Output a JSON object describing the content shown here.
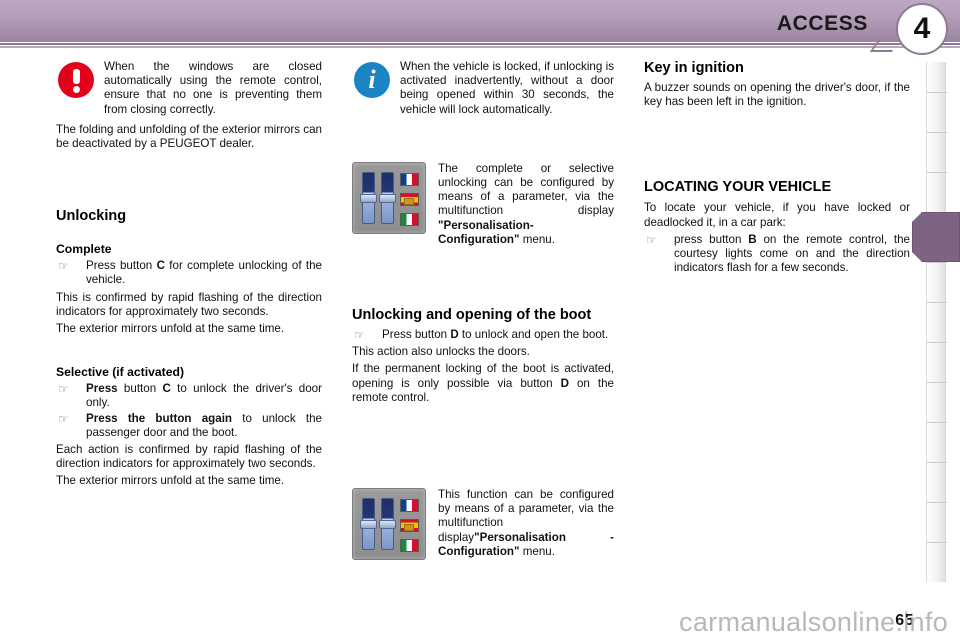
{
  "header": {
    "chapter_title": "ACCESS",
    "chapter_number": "4"
  },
  "left_column": {
    "warning_callout": {
      "icon": "warning-exclamation-icon",
      "text": "When the windows are closed automatically using the remote control, ensure that no one is preventing them from closing correctly."
    },
    "dealer_note": "The folding and unfolding of the exterior mirrors can be deactivated by a PEUGEOT dealer.",
    "unlocking_heading": "Unlocking",
    "complete": {
      "subheading": "Complete",
      "bullet_1_prefix": "Press button ",
      "bullet_1_bold": "C",
      "bullet_1_suffix": " for complete unlocking of the vehicle.",
      "paragraph_1": "This is confirmed by rapid flashing of the direction indicators for approximately two seconds.",
      "paragraph_2": "The exterior mirrors unfold at the same time."
    },
    "selective": {
      "subheading": "Selective (if activated)",
      "bullet_1_bold": "Press",
      "bullet_1_mid": " button ",
      "bullet_1_bold2": "C",
      "bullet_1_suffix": " to unlock the driver's door only.",
      "bullet_2_bold": "Press the button again",
      "bullet_2_suffix": " to unlock the passenger door and the boot.",
      "paragraph_1": "Each action is confirmed by rapid flashing of the direction indicators for approximately two seconds.",
      "paragraph_2": "The exterior mirrors unfold at the same time."
    }
  },
  "middle_column": {
    "info_callout": {
      "icon": "info-circle-icon",
      "text": "When the vehicle is locked, if unlocking is activated inadvertently, without a door being opened within 30 seconds, the vehicle will lock automatically."
    },
    "figure_1": {
      "thumbnail": "multifunction-display-settings-thumbnail",
      "text_prefix": "The complete or selective unlocking can be configured by means of a parameter, via the multifunction display ",
      "text_bold": "\"Personalisation-Configuration\"",
      "text_suffix": " menu."
    },
    "boot_heading": "Unlocking and opening of the boot",
    "boot": {
      "bullet_1_prefix": "Press button ",
      "bullet_1_bold": "D",
      "bullet_1_suffix": " to unlock and open the boot.",
      "paragraph_1": "This action also unlocks the doors.",
      "paragraph_2_prefix": "If the permanent locking of the boot is activated, opening is only possible via button ",
      "paragraph_2_bold": "D",
      "paragraph_2_suffix": " on the remote control."
    },
    "figure_2": {
      "thumbnail": "multifunction-display-settings-thumbnail",
      "text_prefix": "This function can be configured by means of a parameter, via the multifunction display",
      "text_bold": "\"Personalisation - Configuration\"",
      "text_suffix": " menu."
    }
  },
  "right_column": {
    "key_in_ignition_heading": "Key in ignition",
    "key_in_ignition_text": "A buzzer sounds on opening the driver's door, if the key has been left in the ignition.",
    "locating_heading": "LOCATING YOUR VEHICLE",
    "locating_intro": "To locate your vehicle, if you have locked or deadlocked it, in a car park:",
    "locating_bullet_prefix": "press button ",
    "locating_bullet_bold": "B",
    "locating_bullet_suffix": " on the remote control, the courtesy lights come on and the direction indicators flash for a few seconds."
  },
  "footer": {
    "page_number": "65",
    "watermark": "carmanualsonline.info"
  },
  "colors": {
    "header_gradient_top": "#bda8c2",
    "header_gradient_bottom": "#9c849f",
    "active_tab": "#7e6483",
    "warning_red": "#e2001a",
    "info_blue": "#1b84c4"
  }
}
